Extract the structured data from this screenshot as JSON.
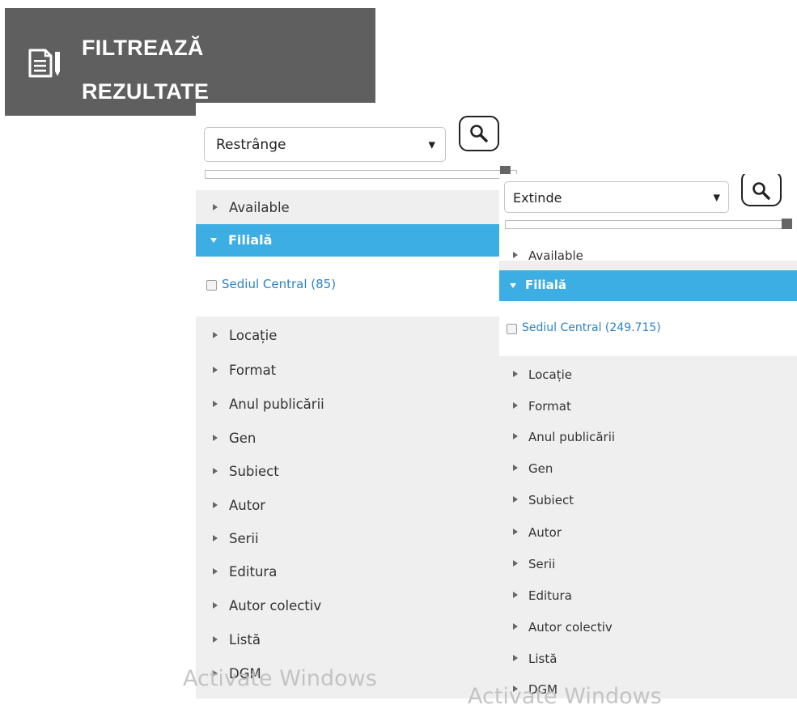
{
  "header": {
    "title_line1": "FILTREAZĂ",
    "title_line2": "REZULTATE",
    "icon": "document-edit-icon"
  },
  "panels": [
    {
      "select": {
        "value": "Restrânge"
      },
      "search_icon": "search-icon",
      "facets_before": [
        {
          "label": "Available"
        }
      ],
      "active_facet": {
        "label": "Filială",
        "option": "Sediul Central (85)"
      },
      "facets_after": [
        {
          "label": "Locație"
        },
        {
          "label": "Format"
        },
        {
          "label": "Anul publicării"
        },
        {
          "label": "Gen"
        },
        {
          "label": "Subiect"
        },
        {
          "label": "Autor"
        },
        {
          "label": "Serii"
        },
        {
          "label": "Editura"
        },
        {
          "label": "Autor colectiv"
        },
        {
          "label": "Listă"
        },
        {
          "label": "DGM"
        }
      ]
    },
    {
      "select": {
        "value": "Extinde"
      },
      "search_icon": "search-icon",
      "facets_before": [
        {
          "label": "Available"
        }
      ],
      "active_facet": {
        "label": "Filială",
        "option": "Sediul Central (249.715)"
      },
      "facets_after": [
        {
          "label": "Locație"
        },
        {
          "label": "Format"
        },
        {
          "label": "Anul publicării"
        },
        {
          "label": "Gen"
        },
        {
          "label": "Subiect"
        },
        {
          "label": "Autor"
        },
        {
          "label": "Serii"
        },
        {
          "label": "Editura"
        },
        {
          "label": "Autor colectiv"
        },
        {
          "label": "Listă"
        },
        {
          "label": "DGM"
        }
      ]
    }
  ],
  "watermark": {
    "text": "Activate Windows"
  }
}
